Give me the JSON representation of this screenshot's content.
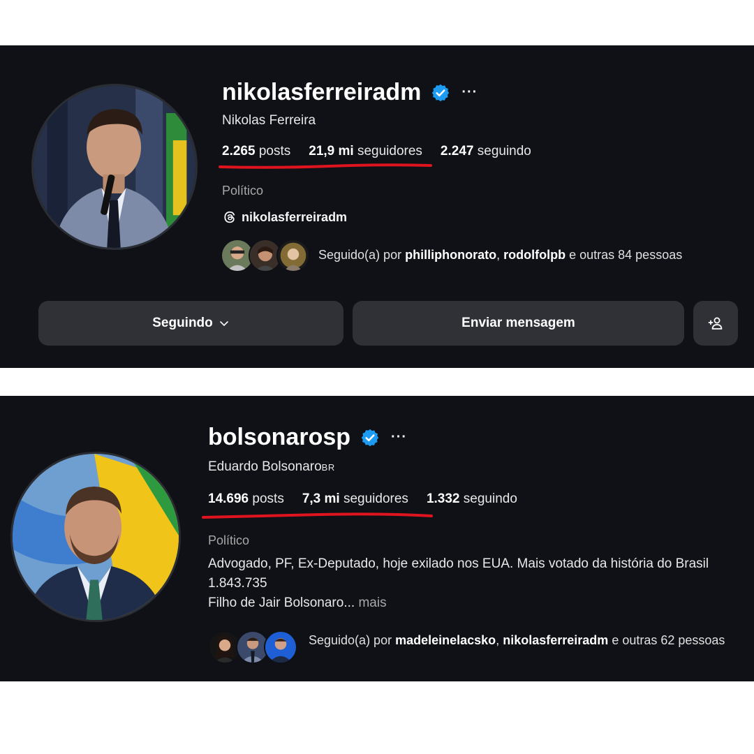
{
  "profiles": [
    {
      "username": "nikolasferreiradm",
      "verified_icon": "verified-badge-icon",
      "more_icon": "···",
      "full_name": "Nikolas Ferreira",
      "full_name_badge": "",
      "stats": {
        "posts_value": "2.265",
        "posts_label": "posts",
        "followers_value": "21,9 mi",
        "followers_label": "seguidores",
        "following_value": "2.247",
        "following_label": "seguindo"
      },
      "category": "Político",
      "threads_handle": "nikolasferreiradm",
      "followed_by": {
        "prefix": "Seguido(a) por",
        "user1": "philliphonorato",
        "separator": ",",
        "user2": "rodolfolpb",
        "suffix": "e outras 84 pessoas"
      },
      "buttons": {
        "following": "Seguindo",
        "message": "Enviar mensagem",
        "add_user_icon": "add-person-icon"
      }
    },
    {
      "username": "bolsonarosp",
      "verified_icon": "verified-badge-icon",
      "more_icon": "···",
      "full_name": "Eduardo Bolsonaro",
      "full_name_badge": "br",
      "stats": {
        "posts_value": "14.696",
        "posts_label": "posts",
        "followers_value": "7,3 mi",
        "followers_label": "seguidores",
        "following_value": "1.332",
        "following_label": "seguindo"
      },
      "category": "Político",
      "bio": {
        "line1": "Advogado, PF, Ex-Deputado, hoje exilado nos EUA. Mais votado da história do Brasil 1.843.735",
        "line2": "Filho de Jair Bolsonaro...",
        "more": "mais"
      },
      "followed_by": {
        "prefix": "Seguido(a) por",
        "user1": "madeleinelacsko",
        "separator": ",",
        "user2": "nikolasferreiradm",
        "suffix": "e outras 62 pessoas"
      }
    }
  ],
  "colors": {
    "background": "#0f1116",
    "button": "#2f3137",
    "verified": "#1d9bf0",
    "underline": "#e0141e"
  }
}
